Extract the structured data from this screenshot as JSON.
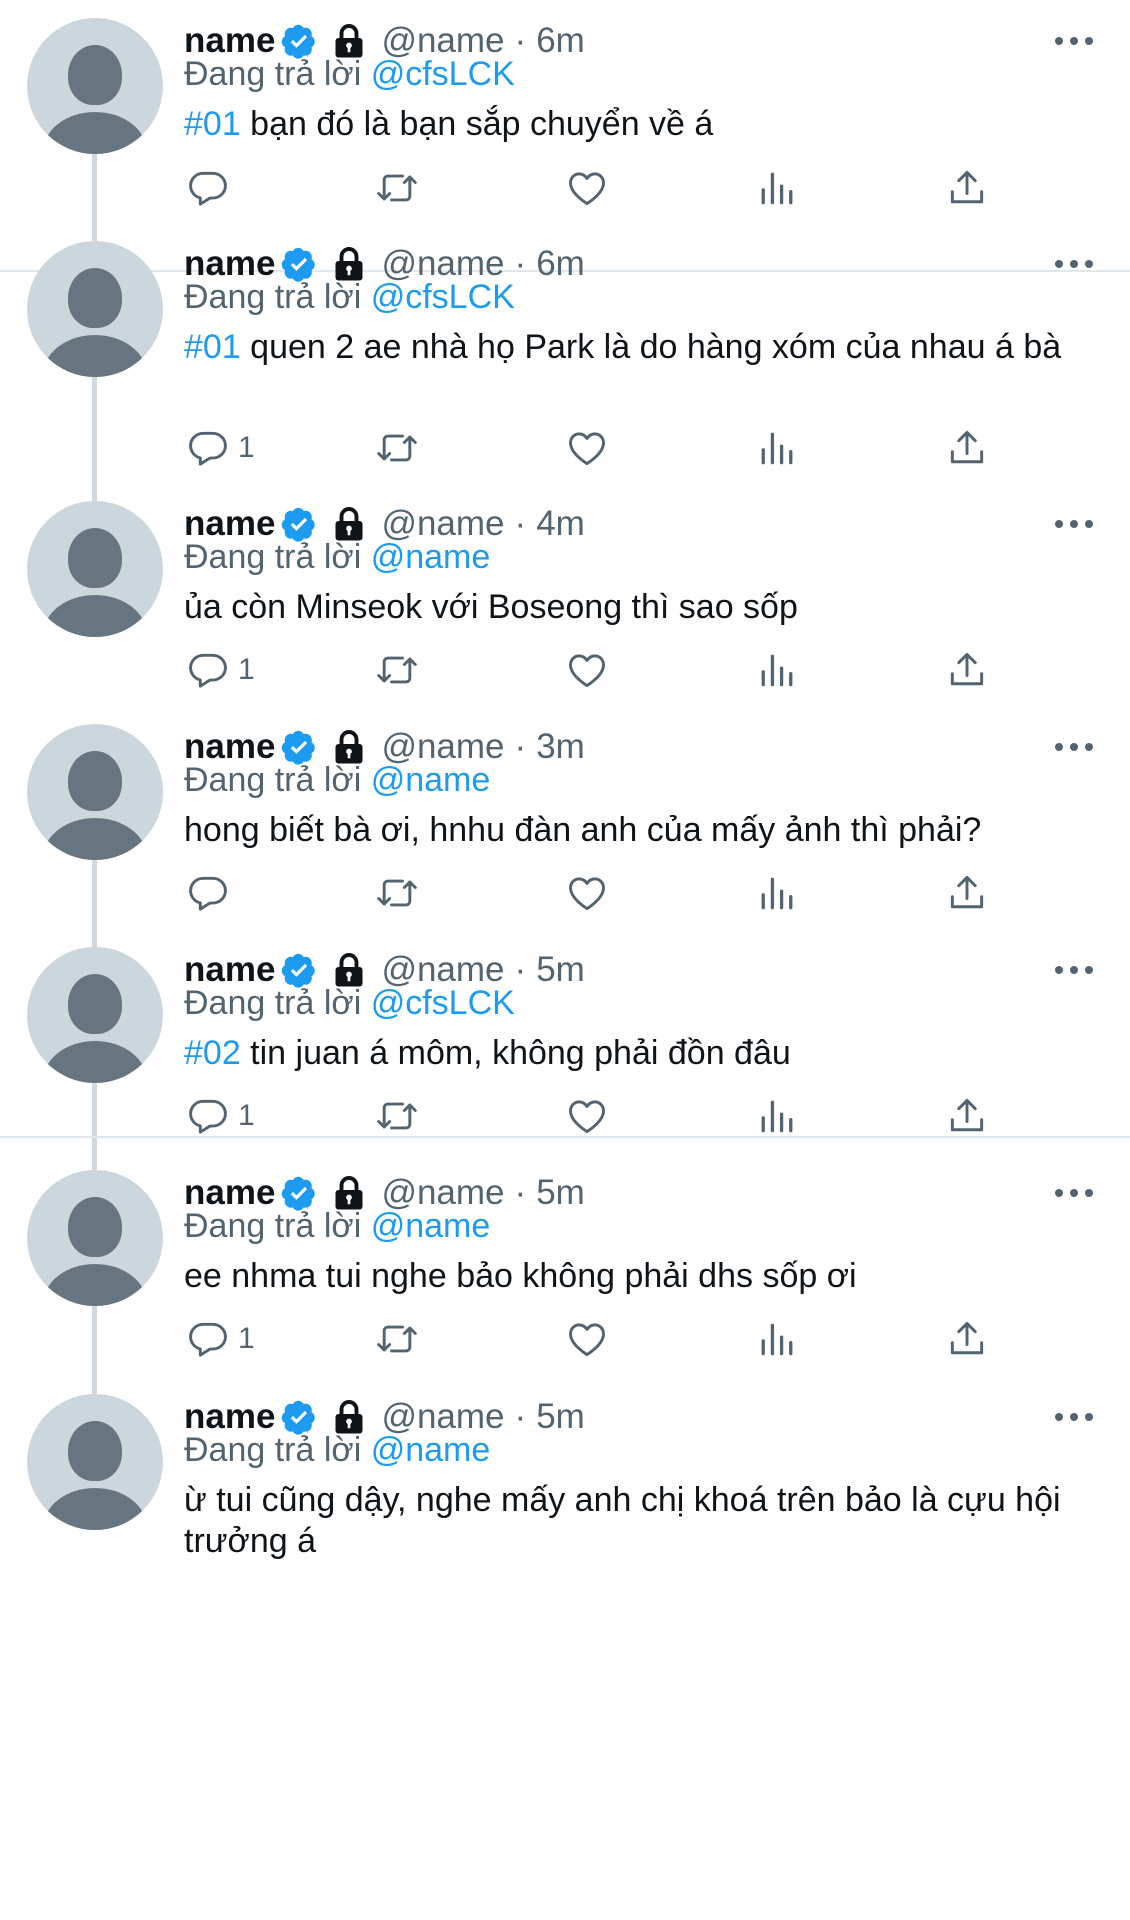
{
  "reply_prefix": "Đang trả lời",
  "tweets": [
    {
      "name": "name",
      "handle": "@name",
      "sep": "·",
      "time": "6m",
      "reply_to": "@cfsLCK",
      "hashtag": "#01",
      "text": " bạn đó là bạn sắp chuyển về á",
      "reply_count": ""
    },
    {
      "name": "name",
      "handle": "@name",
      "sep": "·",
      "time": "6m",
      "reply_to": "@cfsLCK",
      "hashtag": "#01",
      "text": " quen 2 ae nhà họ Park là do hàng xóm của nhau á bà",
      "reply_count": "1"
    },
    {
      "name": "name",
      "handle": "@name",
      "sep": "·",
      "time": "4m",
      "reply_to": "@name",
      "hashtag": "",
      "text": "ủa còn Minseok với Boseong thì sao sốp",
      "reply_count": "1"
    },
    {
      "name": "name",
      "handle": "@name",
      "sep": "·",
      "time": "3m",
      "reply_to": "@name",
      "hashtag": "",
      "text": "hong biết bà ơi, hnhu đàn anh của mấy ảnh thì phải?",
      "reply_count": ""
    },
    {
      "name": "name",
      "handle": "@name",
      "sep": "·",
      "time": "5m",
      "reply_to": "@cfsLCK",
      "hashtag": "#02",
      "text": " tin juan á môm, không phải đồn đâu",
      "reply_count": "1"
    },
    {
      "name": "name",
      "handle": "@name",
      "sep": "·",
      "time": "5m",
      "reply_to": "@name",
      "hashtag": "",
      "text": "ee nhma tui nghe bảo không phải dhs sốp ơi",
      "reply_count": "1"
    },
    {
      "name": "name",
      "handle": "@name",
      "sep": "·",
      "time": "5m",
      "reply_to": "@name",
      "hashtag": "",
      "text": "ừ tui cũng dậy, nghe mấy anh chị khoá trên bảo là cựu hội trưởng á",
      "reply_count": ""
    }
  ],
  "colors": {
    "accent": "#1d9bf0",
    "muted": "#536471",
    "avatar_bg": "#ccd6dd",
    "avatar_fg": "#66757f"
  },
  "icons": [
    "verified-badge-icon",
    "lock-icon",
    "more-icon",
    "reply-icon",
    "retweet-icon",
    "like-icon",
    "analytics-icon",
    "share-icon"
  ]
}
